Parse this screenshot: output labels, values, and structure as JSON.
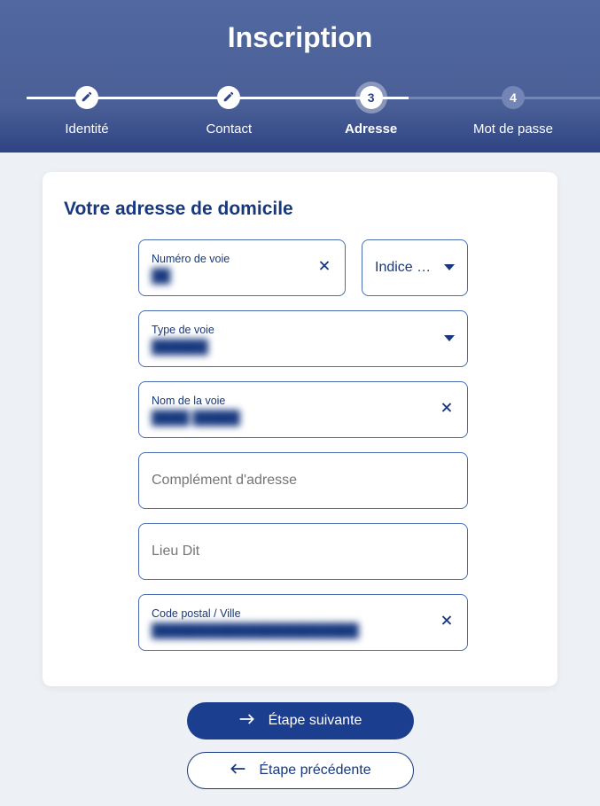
{
  "header": {
    "title": "Inscription"
  },
  "steps": [
    {
      "label": "Identité",
      "state": "done"
    },
    {
      "label": "Contact",
      "state": "done"
    },
    {
      "label": "Adresse",
      "state": "current",
      "number": "3"
    },
    {
      "label": "Mot de passe",
      "state": "pending",
      "number": "4"
    }
  ],
  "card": {
    "title": "Votre adresse de domicile"
  },
  "fields": {
    "numero": {
      "label": "Numéro de voie",
      "value": "██"
    },
    "indice": {
      "label": "Indice d..."
    },
    "type_voie": {
      "label": "Type de voie",
      "value": "██████"
    },
    "nom_voie": {
      "label": "Nom de la voie",
      "value": "████ █████"
    },
    "complement": {
      "placeholder": "Complément d'adresse",
      "value": ""
    },
    "lieu_dit": {
      "placeholder": "Lieu Dit",
      "value": ""
    },
    "code_postal": {
      "label": "Code postal / Ville",
      "value": "██████████████████████"
    }
  },
  "buttons": {
    "next": "Étape suivante",
    "prev": "Étape précédente"
  }
}
